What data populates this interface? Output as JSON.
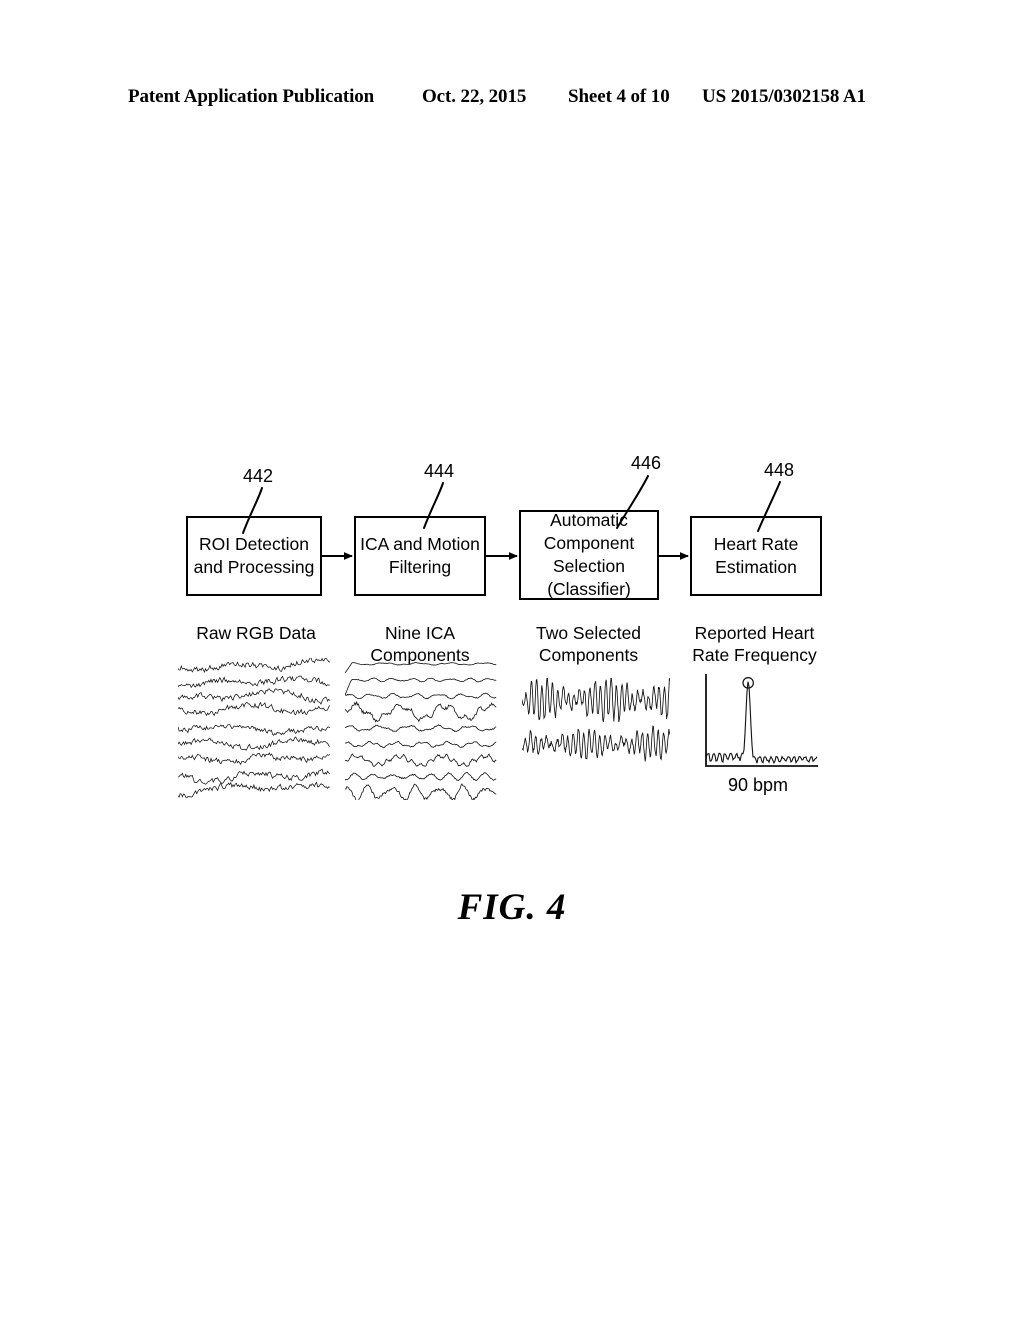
{
  "header": {
    "publication": "Patent Application Publication",
    "date": "Oct. 22, 2015",
    "sheet": "Sheet 4 of 10",
    "publication_number": "US 2015/0302158 A1"
  },
  "figure": {
    "caption": "FIG. 4",
    "boxes": [
      {
        "ref": "442",
        "lines": [
          "ROI Detection",
          "and Processing"
        ],
        "caption_lines": [
          "Raw RGB Data"
        ]
      },
      {
        "ref": "444",
        "lines": [
          "ICA and Motion",
          "Filtering"
        ],
        "caption_lines": [
          "Nine ICA",
          "Components"
        ]
      },
      {
        "ref": "446",
        "lines": [
          "Automatic",
          "Component",
          "Selection",
          "(Classifier)"
        ],
        "caption_lines": [
          "Two Selected",
          "Components"
        ]
      },
      {
        "ref": "448",
        "lines": [
          "Heart Rate",
          "Estimation"
        ],
        "caption_lines": [
          "Reported Heart",
          "Rate Frequency"
        ]
      }
    ],
    "spectrum_label": "90 bpm"
  },
  "chart_data": [
    {
      "type": "line",
      "name": "raw-rgb-data",
      "title": "Raw RGB Data",
      "description": "Nine overlapping noisy RGB intensity traces over time",
      "n_traces": 9,
      "xlabel": "",
      "ylabel": "",
      "grid": false,
      "axes_visible": false
    },
    {
      "type": "line",
      "name": "nine-ica-components",
      "title": "Nine ICA Components",
      "description": "Nine separated independent component time series stacked vertically",
      "n_traces": 9,
      "trace_amplitudes": [
        0.12,
        0.18,
        0.25,
        0.85,
        0.3,
        0.28,
        0.6,
        0.35,
        0.75
      ],
      "xlabel": "",
      "ylabel": "",
      "grid": false,
      "axes_visible": false
    },
    {
      "type": "line",
      "name": "two-selected-components",
      "title": "Two Selected Components",
      "description": "Two high-amplitude periodic components selected by the classifier",
      "n_traces": 2,
      "trace_amplitudes": [
        1.0,
        0.72
      ],
      "xlabel": "",
      "ylabel": "",
      "grid": false,
      "axes_visible": false
    },
    {
      "type": "line",
      "name": "reported-heart-rate-frequency",
      "title": "Reported Heart Rate Frequency",
      "description": "Power spectrum with a single dominant peak marked by a circle at 90 bpm",
      "annotation": "90 bpm",
      "peak_x_fraction": 0.38,
      "peak_y_fraction": 0.92,
      "noise_floor_fraction": 0.12,
      "xlabel": "",
      "ylabel": "",
      "grid": false,
      "axes_visible": true
    }
  ]
}
